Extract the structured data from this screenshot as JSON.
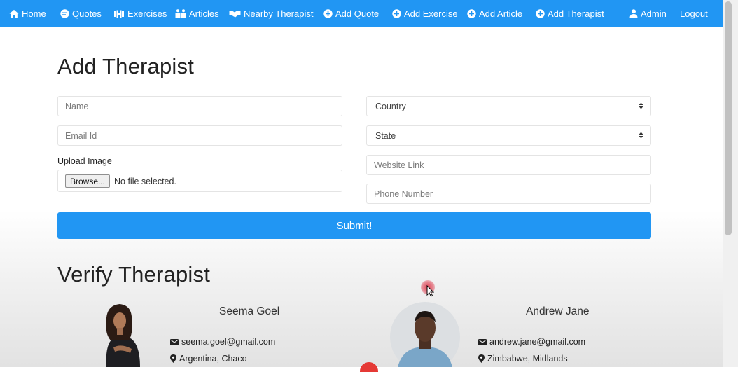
{
  "nav": {
    "home": "Home",
    "quotes": "Quotes",
    "exercises": "Exercises",
    "articles": "Articles",
    "nearby_therapist": "Nearby Therapist",
    "add_quote": "Add Quote",
    "add_exercise": "Add Exercise",
    "add_article": "Add Article",
    "add_therapist": "Add Therapist",
    "admin": "Admin",
    "logout": "Logout"
  },
  "add_form": {
    "title": "Add Therapist",
    "name_placeholder": "Name",
    "email_placeholder": "Email Id",
    "upload_label": "Upload Image",
    "browse_label": "Browse...",
    "file_status": "No file selected.",
    "country_value": "Country",
    "state_value": "State",
    "website_placeholder": "Website Link",
    "phone_placeholder": "Phone Number",
    "submit_label": "Submit!"
  },
  "verify": {
    "title": "Verify Therapist",
    "cards": [
      {
        "name": "Seema Goel",
        "email": "seema.goel@gmail.com",
        "location": "Argentina, Chaco"
      },
      {
        "name": "Andrew Jane",
        "email": "andrew.jane@gmail.com",
        "location": "Zimbabwe, Midlands"
      }
    ]
  },
  "colors": {
    "accent": "#2196f3",
    "text": "#212529",
    "border": "#e4e4e4"
  }
}
